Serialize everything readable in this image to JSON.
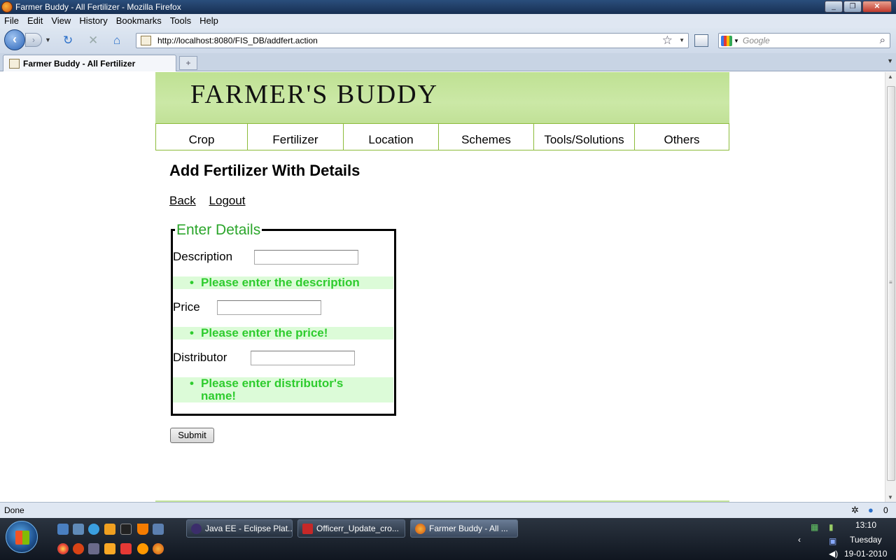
{
  "window": {
    "title": "Farmer Buddy - All Fertilizer - Mozilla Firefox",
    "controls": [
      "_",
      "❐",
      "✕"
    ]
  },
  "menu": [
    "File",
    "Edit",
    "View",
    "History",
    "Bookmarks",
    "Tools",
    "Help"
  ],
  "toolbar": {
    "url": "http://localhost:8080/FIS_DB/addfert.action",
    "search_placeholder": "Google",
    "icons": [
      "back-arrow-icon",
      "forward-arrow-icon",
      "reload-icon",
      "stop-icon",
      "home-icon",
      "bookmark-star-icon",
      "search-magnifier-icon"
    ]
  },
  "tabs": [
    {
      "label": "Farmer Buddy - All Fertilizer"
    }
  ],
  "site": {
    "logo": "FARMER'S BUDDY",
    "nav": [
      "Crop",
      "Fertilizer",
      "Location",
      "Schemes",
      "Tools/Solutions",
      "Others"
    ],
    "page_title": "Add Fertilizer With Details",
    "links": {
      "back": "Back",
      "logout": "Logout"
    },
    "form": {
      "legend": "Enter Details",
      "description_label": "Description",
      "description_value": "",
      "description_error": "Please enter the description",
      "price_label": "Price",
      "price_value": "",
      "price_error": "Please enter the price!",
      "distributor_label": "Distributor",
      "distributor_value": "",
      "distributor_error_line1": "Please enter distributor's",
      "distributor_error_line2": "name!",
      "submit": "Submit"
    }
  },
  "status": {
    "text": "Done",
    "count": "0"
  },
  "taskbar": {
    "tasks": [
      "Java EE - Eclipse Plat...",
      "Officerr_Update_cro...",
      "Farmer Buddy - All ..."
    ],
    "clock_time": "13:10",
    "clock_day": "Tuesday",
    "clock_date": "19-01-2010"
  },
  "colors": {
    "header_green": "#c3e49b",
    "nav_border": "#8cbb3a",
    "legend_green": "#2aa52a",
    "error_text": "#2ecc2e",
    "error_bg": "#dcfbd8"
  }
}
